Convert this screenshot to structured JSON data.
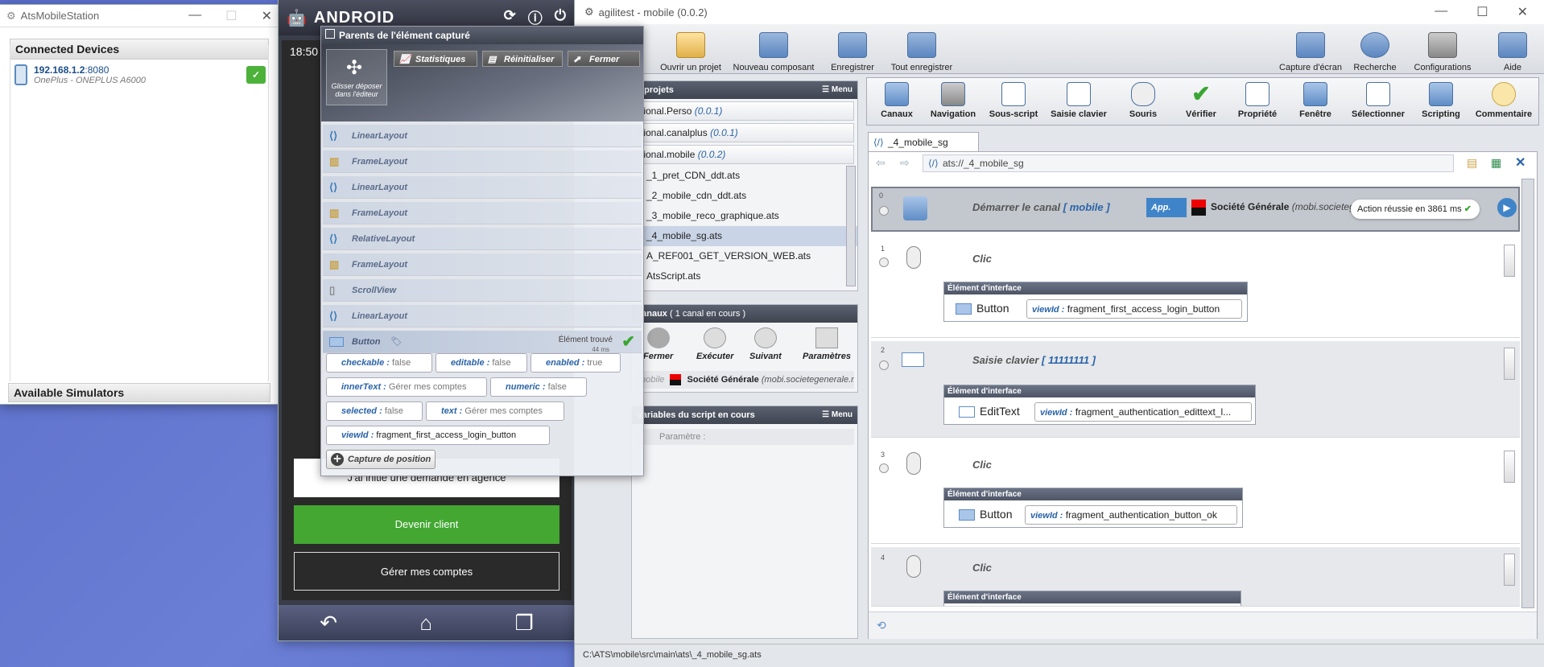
{
  "ams": {
    "title": "AtsMobileStation",
    "connected_header": "Connected Devices",
    "device_ip": "192.168.1.2",
    "device_port": ":8080",
    "device_model": "OnePlus - ONEPLUS A6000",
    "simulators_header": "Available Simulators"
  },
  "android": {
    "logo": "ANDROID",
    "time": "18:50",
    "btn_agence": "J'ai initié une demande en agence",
    "btn_client": "Devenir client",
    "btn_comptes": "Gérer mes comptes"
  },
  "popup": {
    "title": "Parents de l'élément capturé",
    "drag_label": "Glisser déposer dans l'éditeur",
    "btn_stats": "Statistiques",
    "btn_reset": "Réinitialiser",
    "btn_close": "Fermer",
    "nodes": [
      "LinearLayout",
      "FrameLayout",
      "LinearLayout",
      "FrameLayout",
      "RelativeLayout",
      "FrameLayout",
      "ScrollView",
      "LinearLayout"
    ],
    "selected": "Button",
    "found_label": "Élément trouvé",
    "found_time": "44 ms",
    "props": [
      {
        "k": "checkable :",
        "v": "false"
      },
      {
        "k": "editable :",
        "v": "false"
      },
      {
        "k": "enabled :",
        "v": "true"
      },
      {
        "k": "innerText :",
        "v": "Gérer mes comptes"
      },
      {
        "k": "numeric :",
        "v": "false"
      },
      {
        "k": "selected :",
        "v": "false"
      },
      {
        "k": "text :",
        "v": "Gérer mes comptes"
      },
      {
        "k": "viewId :",
        "v": "fragment_first_access_login_button"
      }
    ],
    "capture": "Capture de position"
  },
  "agilitest": {
    "title": "agilitest - mobile (0.0.2)",
    "top_tools": [
      "Ouvrir un projet",
      "Nouveau composant",
      "Enregistrer",
      "Tout enregistrer"
    ],
    "right_tools": [
      "Capture d'écran",
      "Recherche",
      "Configurations",
      "Aide"
    ],
    "actions": [
      "Canaux",
      "Navigation",
      "Sous-script",
      "Saisie clavier",
      "Souris",
      "Vérifier",
      "Propriété",
      "Fenêtre",
      "Sélectionner",
      "Scripting",
      "Commentaire"
    ],
    "projects_header": "e projets",
    "menu": "Menu",
    "projects": [
      {
        "n": "ctional.Perso",
        "v": "(0.0.1)"
      },
      {
        "n": "ctional.canalplus",
        "v": "(0.0.1)"
      },
      {
        "n": "ctional.mobile",
        "v": "(0.0.2)"
      }
    ],
    "files": [
      "_1_pret_CDN_ddt.ats",
      "_2_mobile_cdn_ddt.ats",
      "_3_mobile_reco_graphique.ats",
      "_4_mobile_sg.ats",
      "A_REF001_GET_VERSION_WEB.ats",
      "AtsScript.ats"
    ],
    "canaux_header": "canaux",
    "canaux_count": "( 1 canal en cours )",
    "canaux_btns": [
      "Fermer",
      "Exécuter",
      "Suivant",
      "Paramètres"
    ],
    "canal_name": "mobile",
    "canal_app": "Société Générale",
    "canal_pkg": "(mobi.societegenerale.mobi",
    "script_header": "Variables du script en cours",
    "script_line": "Paramètre :",
    "tab": "_4_mobile_sg",
    "path": "ats://_4_mobile_sg",
    "steps": [
      {
        "n": "0",
        "action": "Démarrer le canal",
        "extra": "[ mobile ]",
        "app_label": "App.",
        "app_name": "Société Générale",
        "app_pkg": "(mobi.societeg",
        "result": "Action réussie en 3861 ms"
      },
      {
        "n": "1",
        "action": "Clic",
        "elem_header": "Élément d'interface",
        "tag": "Button",
        "vid_k": "viewId :",
        "vid_v": "fragment_first_access_login_button"
      },
      {
        "n": "2",
        "action": "Saisie clavier",
        "extra": "[ 11111111 ]",
        "elem_header": "Élément d'interface",
        "tag": "EditText",
        "vid_k": "viewId :",
        "vid_v": "fragment_authentication_edittext_l..."
      },
      {
        "n": "3",
        "action": "Clic",
        "elem_header": "Élément d'interface",
        "tag": "Button",
        "vid_k": "viewId :",
        "vid_v": "fragment_authentication_button_ok"
      },
      {
        "n": "4",
        "action": "Clic",
        "elem_header": "Élément d'interface"
      }
    ],
    "status_path": "C:\\ATS\\mobile\\src\\main\\ats\\_4_mobile_sg.ats"
  },
  "colors": {
    "green": "#3aa632",
    "accent": "#2a64a8"
  }
}
